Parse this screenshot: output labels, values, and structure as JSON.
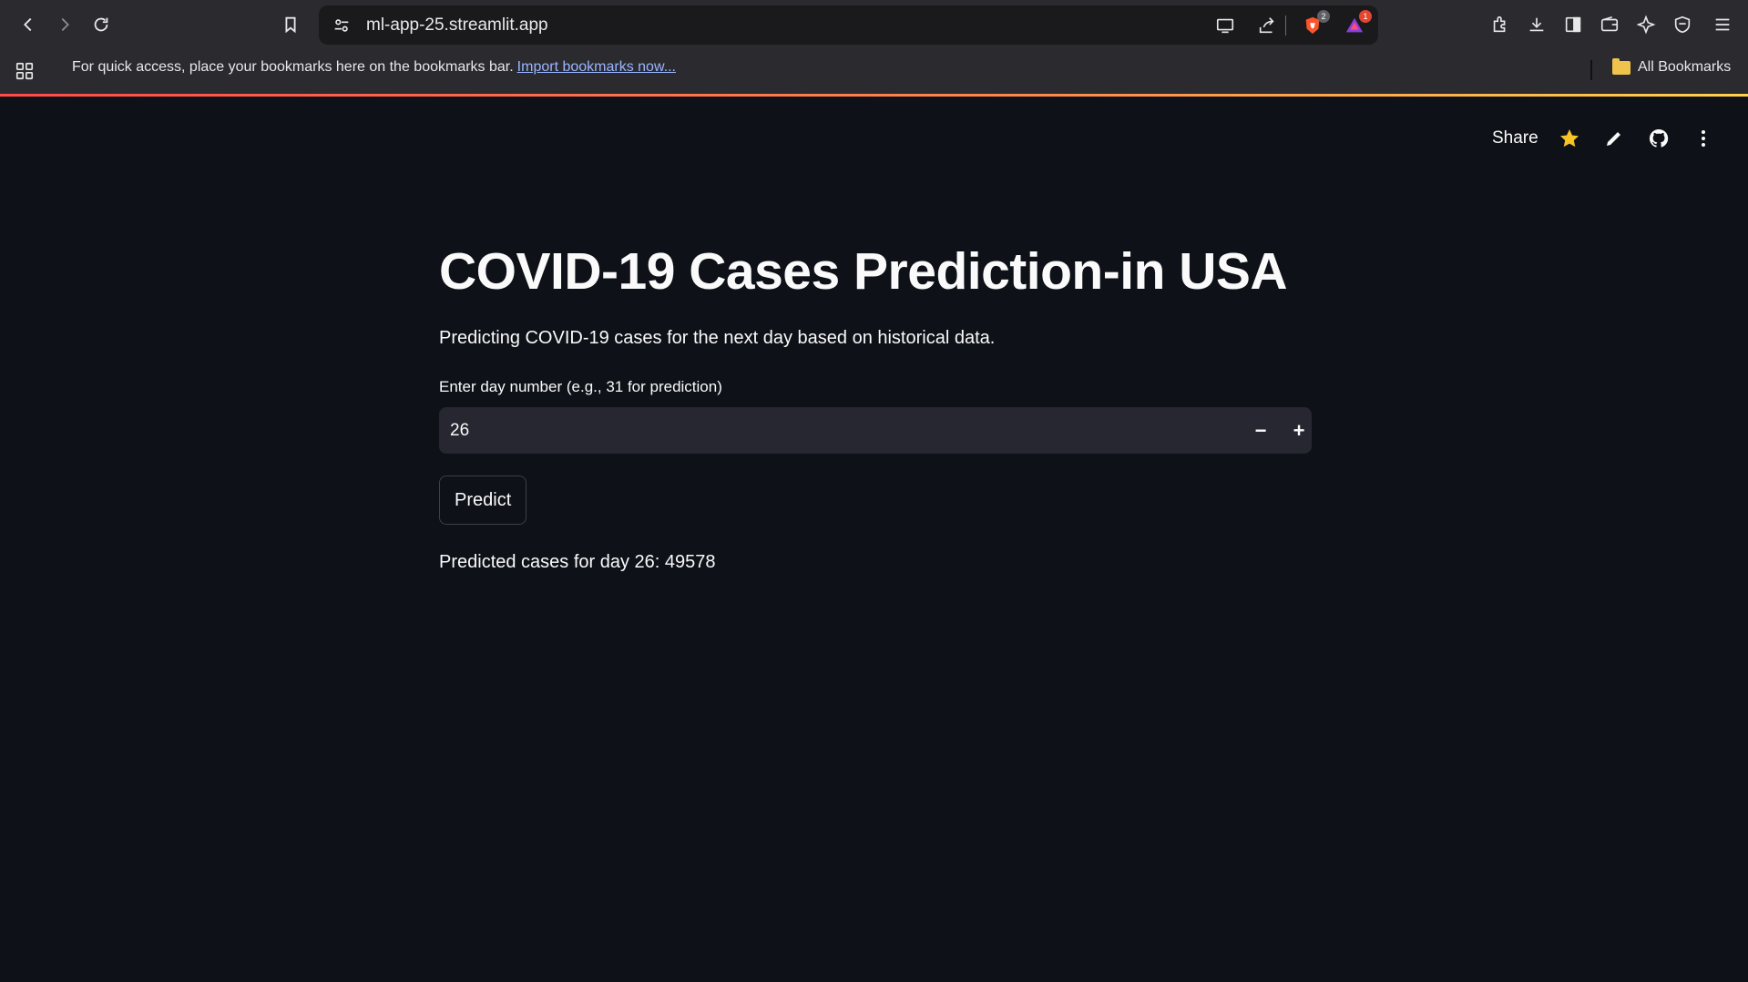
{
  "browser": {
    "url": "ml-app-25.streamlit.app",
    "shields_count": "2",
    "rewards_count": "1",
    "bookmarks_bar": {
      "message": "For quick access, place your bookmarks here on the bookmarks bar.",
      "import_link": "Import bookmarks now...",
      "all_bookmarks": "All Bookmarks"
    }
  },
  "app_header": {
    "share_label": "Share"
  },
  "main": {
    "title": "COVID-19 Cases Prediction-in USA",
    "description": "Predicting COVID-19 cases for the next day based on historical data.",
    "day_input": {
      "label": "Enter day number (e.g., 31 for prediction)",
      "value": "26",
      "decrement": "−",
      "increment": "+"
    },
    "predict_button": "Predict",
    "result": "Predicted cases for day 26: 49578"
  },
  "colors": {
    "background": "#0e1117",
    "input_bg": "#262730",
    "text": "#fafafa",
    "star": "#f7c325"
  }
}
